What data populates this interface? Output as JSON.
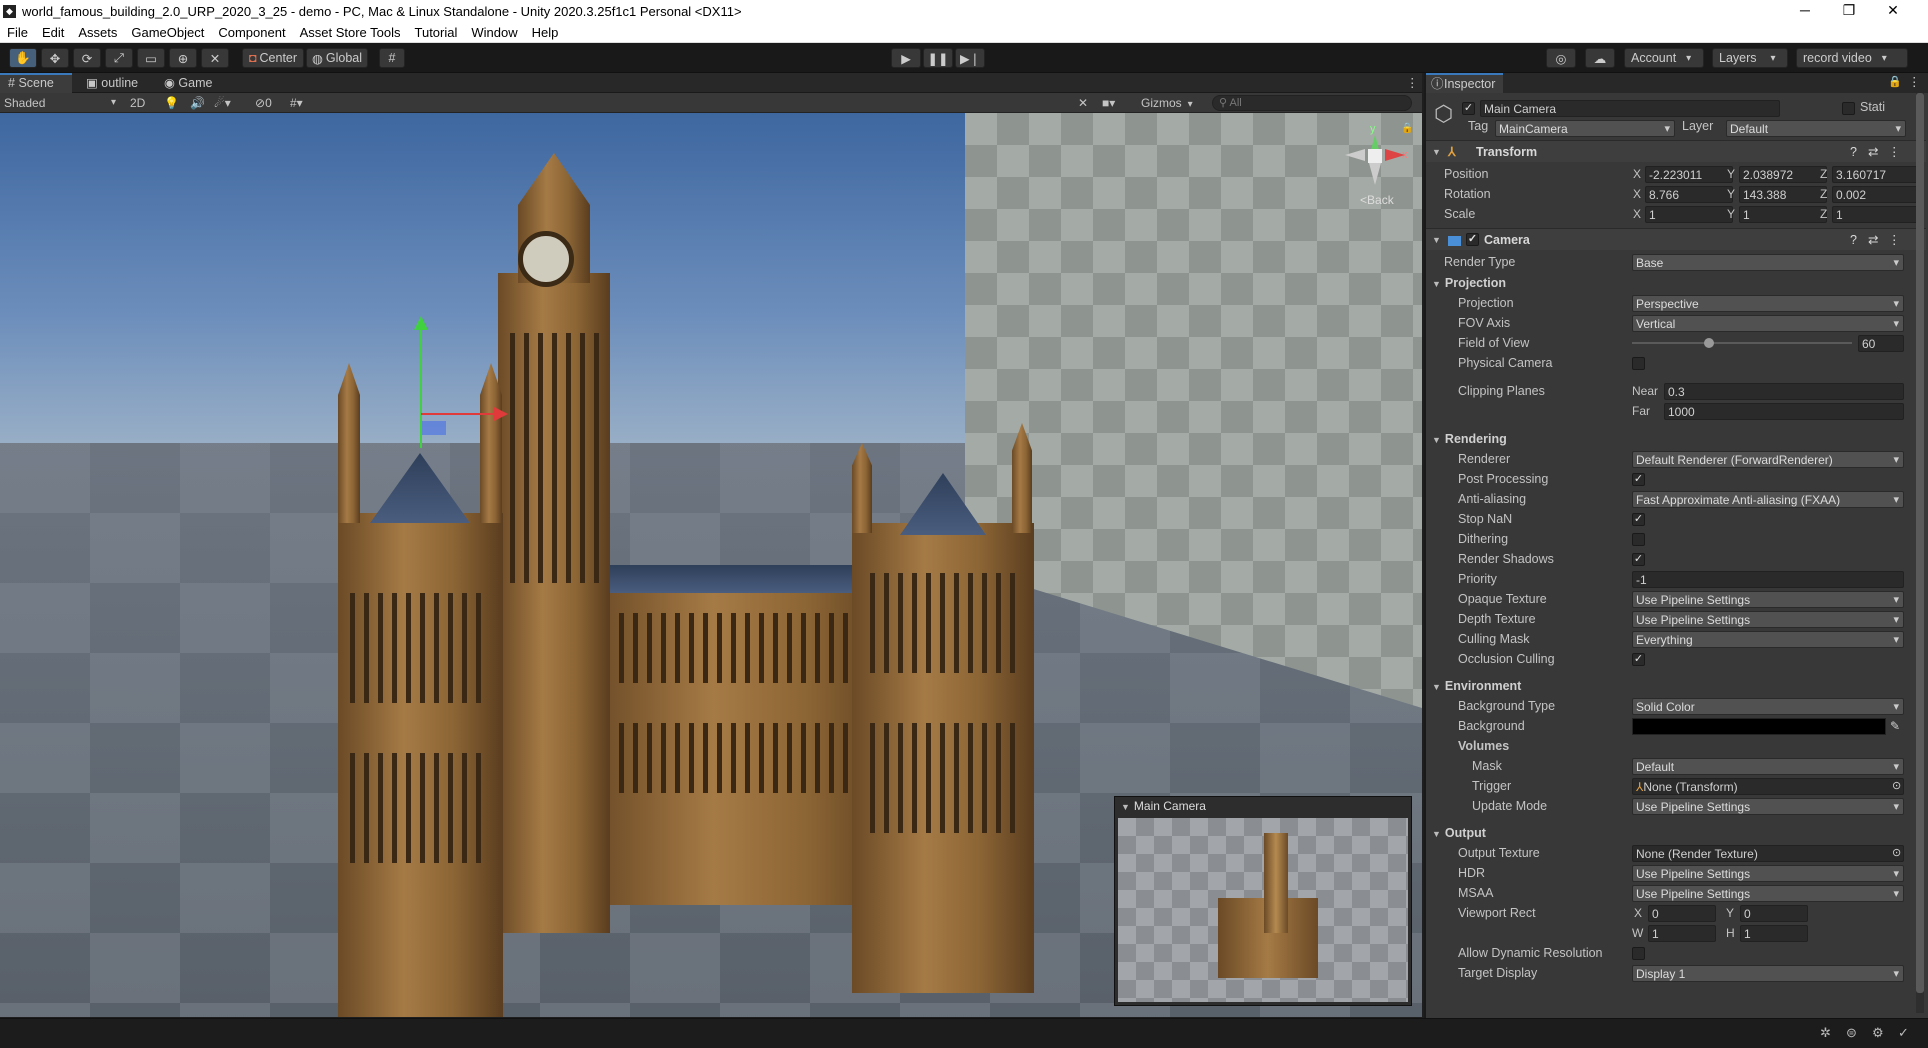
{
  "window": {
    "title": "world_famous_building_2.0_URP_2020_3_25 - demo - PC, Mac & Linux Standalone - Unity 2020.3.25f1c1 Personal <DX11>",
    "minimize": "─",
    "maximize": "❐",
    "close": "✕"
  },
  "menu": [
    "File",
    "Edit",
    "Assets",
    "GameObject",
    "Component",
    "Asset Store Tools",
    "Tutorial",
    "Window",
    "Help"
  ],
  "toolbar": {
    "center": "Center",
    "global": "Global",
    "account": "Account",
    "layers": "Layers",
    "layout": "record video"
  },
  "scene_tabs": {
    "scene": "Scene",
    "outline": "outline",
    "game": "Game"
  },
  "scene_bar": {
    "shading": "Shaded",
    "two_d": "2D",
    "hidden_count": "0",
    "gizmos": "Gizmos",
    "search_placeholder": "All"
  },
  "orientation": {
    "y": "y",
    "x": "x",
    "view": "Back"
  },
  "camera_preview": {
    "title": "Main Camera"
  },
  "inspector": {
    "tab": "Inspector",
    "object_name": "Main Camera",
    "static_label": "Stati",
    "tag_label": "Tag",
    "tag_value": "MainCamera",
    "layer_label": "Layer",
    "layer_value": "Default",
    "transform": {
      "title": "Transform",
      "position": {
        "label": "Position",
        "x": "-2.223011",
        "y": "2.038972",
        "z": "3.160717"
      },
      "rotation": {
        "label": "Rotation",
        "x": "8.766",
        "y": "143.388",
        "z": "0.002"
      },
      "scale": {
        "label": "Scale",
        "x": "1",
        "y": "1",
        "z": "1"
      }
    },
    "camera": {
      "title": "Camera",
      "render_type": {
        "label": "Render Type",
        "value": "Base"
      },
      "projection_header": "Projection",
      "projection": {
        "label": "Projection",
        "value": "Perspective"
      },
      "fov_axis": {
        "label": "FOV Axis",
        "value": "Vertical"
      },
      "field_of_view": {
        "label": "Field of View",
        "value": "60",
        "slider_fraction": 0.35
      },
      "physical_camera": {
        "label": "Physical Camera"
      },
      "clipping": {
        "label": "Clipping Planes",
        "near_label": "Near",
        "near": "0.3",
        "far_label": "Far",
        "far": "1000"
      },
      "rendering_header": "Rendering",
      "renderer": {
        "label": "Renderer",
        "value": "Default Renderer (ForwardRenderer)"
      },
      "post_processing": {
        "label": "Post Processing",
        "checked": "✓"
      },
      "anti_aliasing": {
        "label": "Anti-aliasing",
        "value": "Fast Approximate Anti-aliasing (FXAA)"
      },
      "stop_nan": {
        "label": "Stop NaN",
        "checked": "✓"
      },
      "dithering": {
        "label": "Dithering"
      },
      "render_shadows": {
        "label": "Render Shadows",
        "checked": "✓"
      },
      "priority": {
        "label": "Priority",
        "value": "-1"
      },
      "opaque_texture": {
        "label": "Opaque Texture",
        "value": "Use Pipeline Settings"
      },
      "depth_texture": {
        "label": "Depth Texture",
        "value": "Use Pipeline Settings"
      },
      "culling_mask": {
        "label": "Culling Mask",
        "value": "Everything"
      },
      "occlusion_culling": {
        "label": "Occlusion Culling",
        "checked": "✓"
      },
      "environment_header": "Environment",
      "background_type": {
        "label": "Background Type",
        "value": "Solid Color"
      },
      "background": {
        "label": "Background",
        "color": "#000000"
      },
      "volumes_header": "Volumes",
      "mask": {
        "label": "Mask",
        "value": "Default"
      },
      "trigger": {
        "label": "Trigger",
        "value": "None (Transform)"
      },
      "update_mode": {
        "label": "Update Mode",
        "value": "Use Pipeline Settings"
      },
      "output_header": "Output",
      "output_texture": {
        "label": "Output Texture",
        "value": "None (Render Texture)"
      },
      "hdr": {
        "label": "HDR",
        "value": "Use Pipeline Settings"
      },
      "msaa": {
        "label": "MSAA",
        "value": "Use Pipeline Settings"
      },
      "viewport_rect": {
        "label": "Viewport Rect",
        "x": "0",
        "y": "0",
        "w": "1",
        "h": "1"
      },
      "allow_dynamic_resolution": {
        "label": "Allow Dynamic Resolution"
      },
      "target_display": {
        "label": "Target Display",
        "value": "Display 1"
      }
    }
  },
  "colors": {
    "accent": "#3a79bb",
    "panel": "#383838",
    "toolbar": "#191919"
  }
}
